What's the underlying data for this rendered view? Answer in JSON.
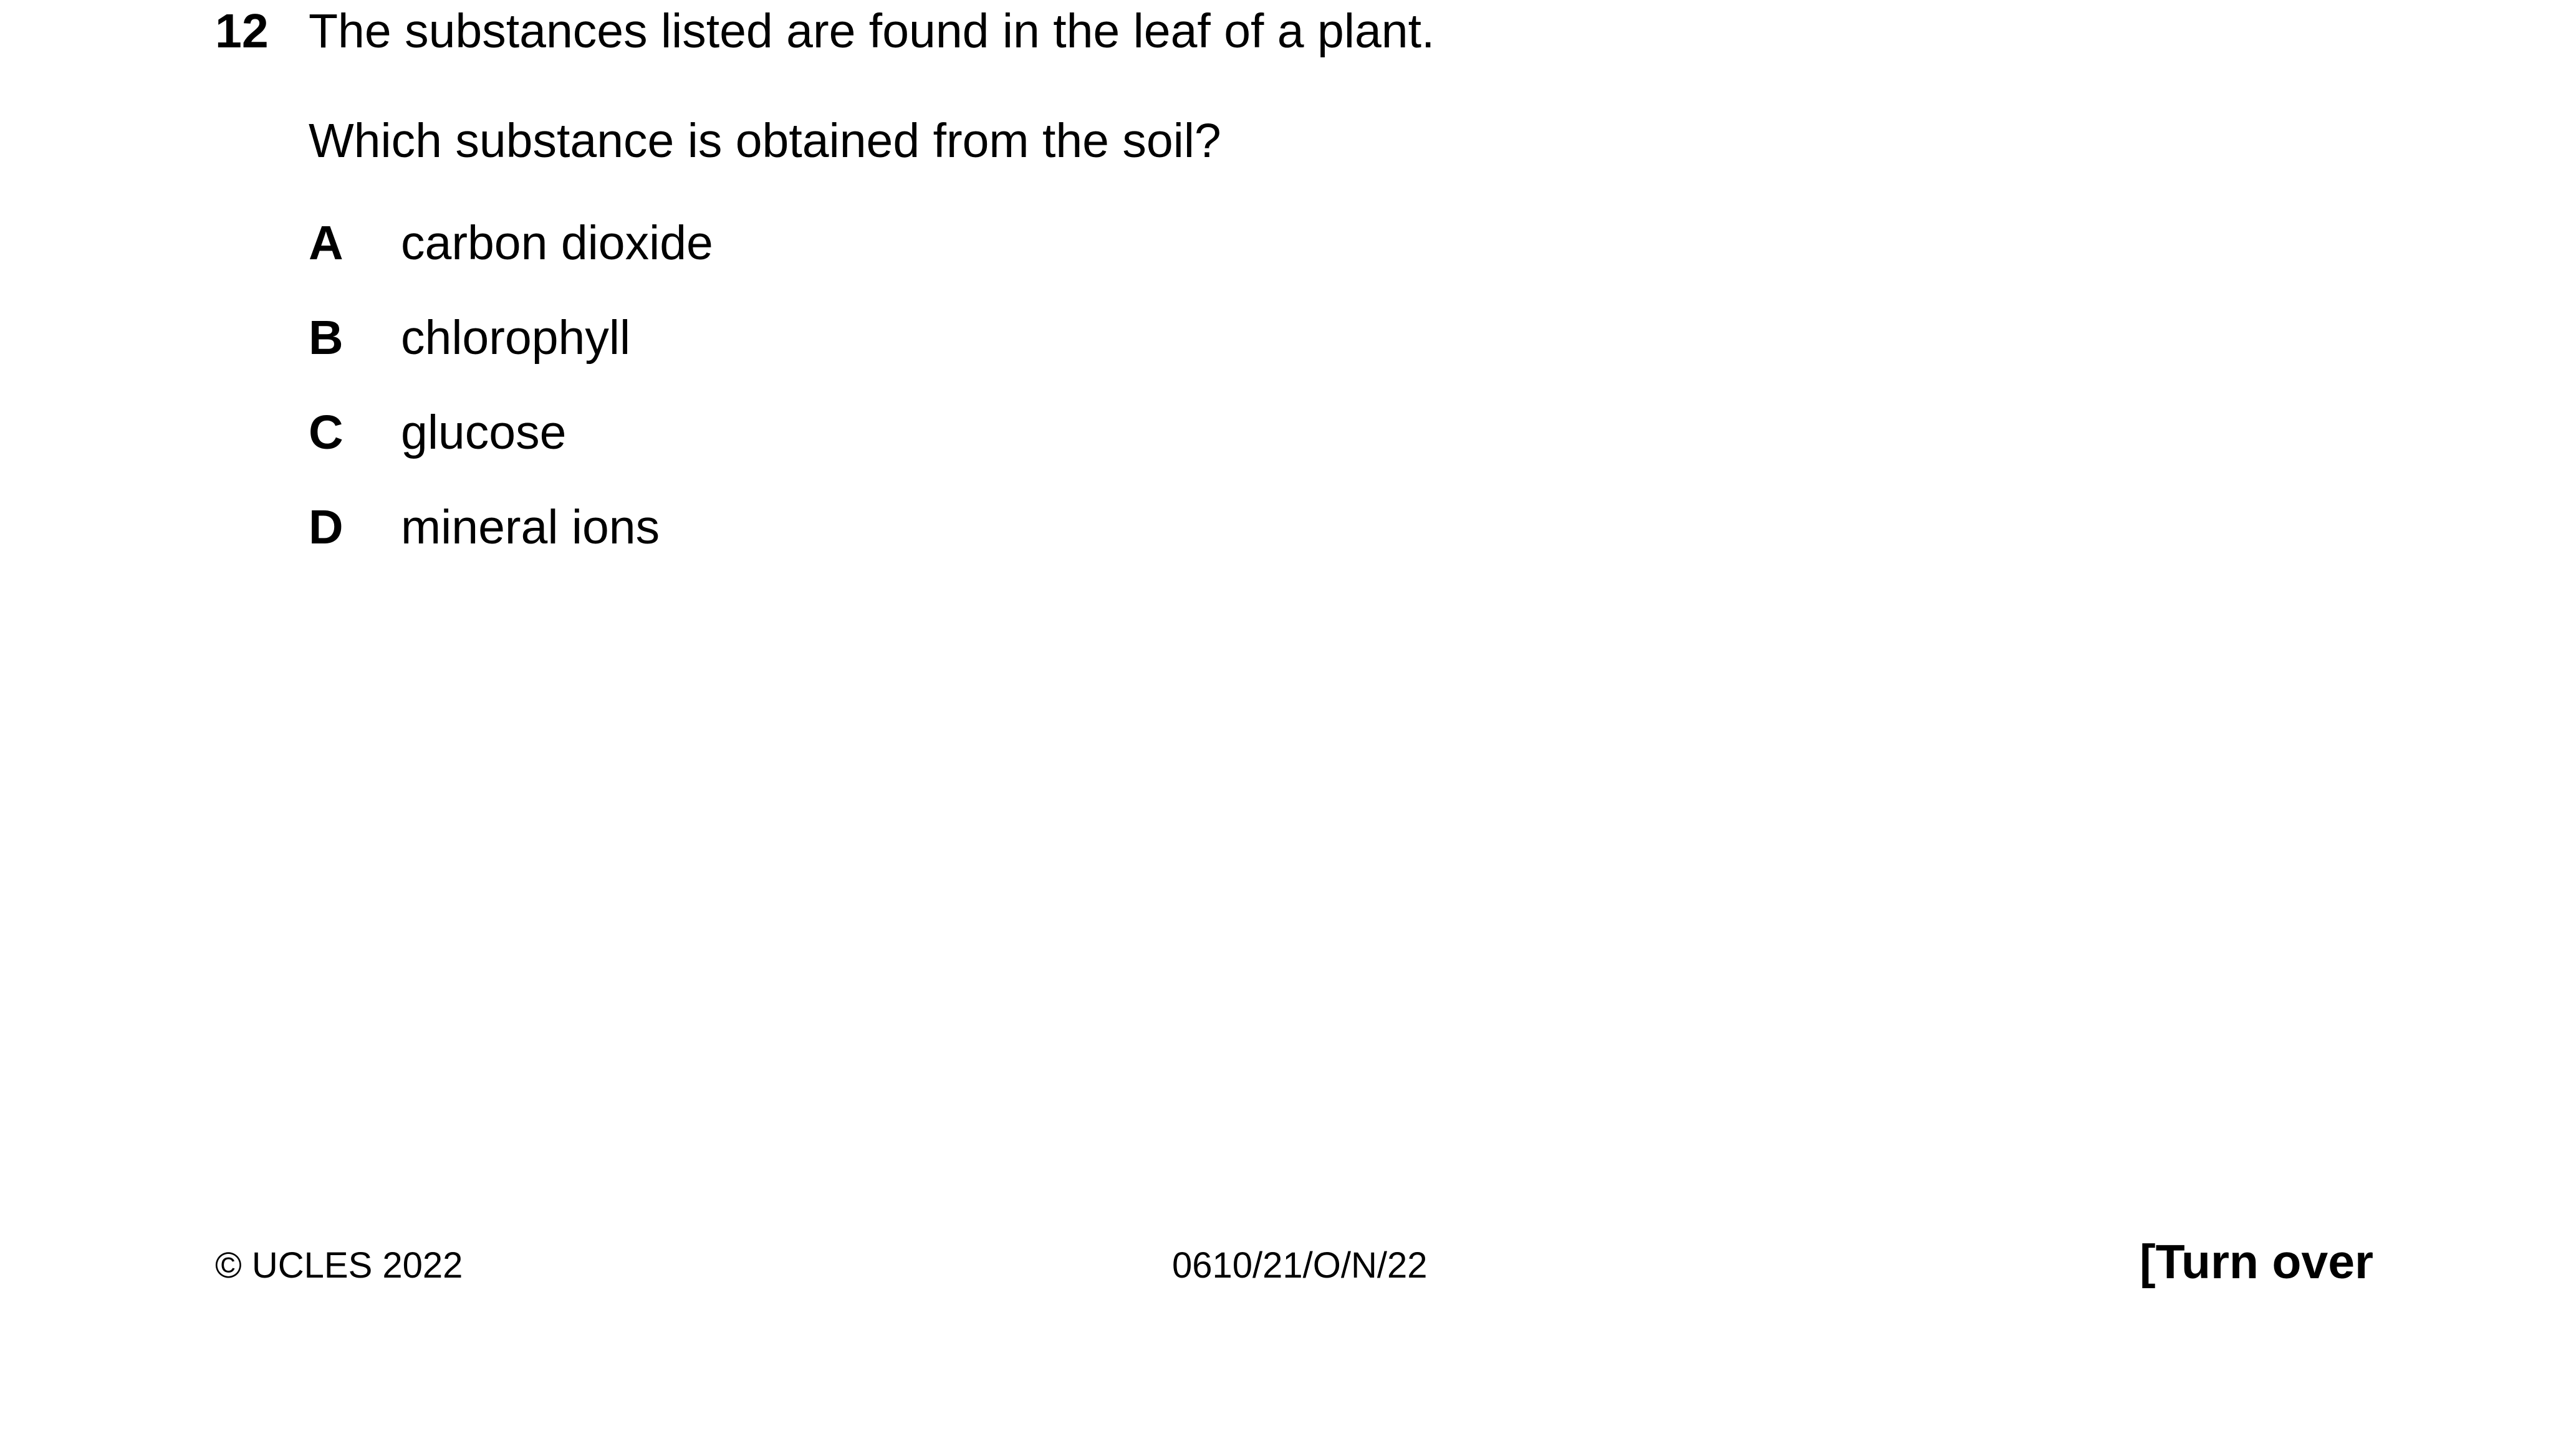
{
  "question": {
    "number": "12",
    "stem": "The substances listed are found in the leaf of a plant.",
    "prompt": "Which substance is obtained from the soil?",
    "options": [
      {
        "letter": "A",
        "text": "carbon dioxide"
      },
      {
        "letter": "B",
        "text": "chlorophyll"
      },
      {
        "letter": "C",
        "text": "glucose"
      },
      {
        "letter": "D",
        "text": "mineral ions"
      }
    ]
  },
  "footer": {
    "copyright": "© UCLES 2022",
    "paper_code": "0610/21/O/N/22",
    "turn_over": "[Turn over"
  }
}
